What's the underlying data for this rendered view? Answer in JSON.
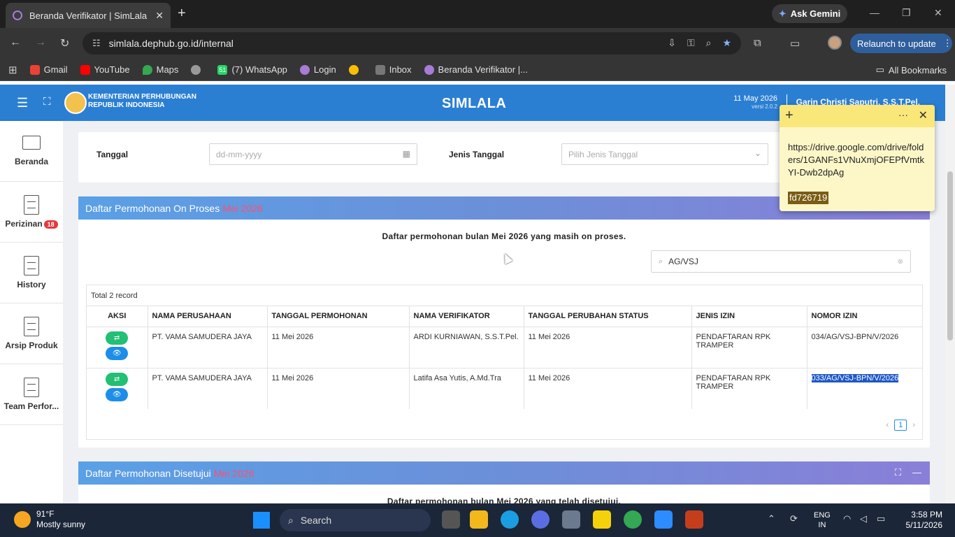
{
  "browser": {
    "tab_title": "Beranda Verifikator | SimLala",
    "gemini_label": "Ask Gemini",
    "url": "simlala.dephub.go.id/internal",
    "relaunch_label": "Relaunch to update",
    "bookmarks": [
      "Gmail",
      "YouTube",
      "Maps",
      "(7) WhatsApp",
      "Login",
      "Inbox",
      "Beranda Verifikator |..."
    ],
    "bookmark_whatsapp_count": "51",
    "all_bookmarks": "All Bookmarks"
  },
  "app": {
    "ministry_line1": "KEMENTERIAN PERHUBUNGAN",
    "ministry_line2": "REPUBLIK INDONESIA",
    "title": "SIMLALA",
    "date": "11 May 2026",
    "version": "versi 2.0.2",
    "user": "Garin Christi Saputri, S.S.T.Pel."
  },
  "sidebar": {
    "items": [
      {
        "label": "Beranda"
      },
      {
        "label": "Perizinan",
        "badge": "18"
      },
      {
        "label": "History"
      },
      {
        "label": "Arsip Produk"
      },
      {
        "label": "Team Perfor..."
      }
    ]
  },
  "filter": {
    "tanggal_label": "Tanggal",
    "tanggal_placeholder": "dd-mm-yyyy",
    "jenis_label": "Jenis Tanggal",
    "jenis_placeholder": "Pilih Jenis Tanggal"
  },
  "panel_onproses": {
    "title": "Daftar Permohonan On Proses",
    "month": "Mei 2026",
    "description": "Daftar permohonan bulan Mei 2026 yang masih on proses.",
    "search_value": "AG/VSJ",
    "total": "Total 2 record",
    "columns": [
      "AKSI",
      "NAMA PERUSAHAAN",
      "TANGGAL PERMOHONAN",
      "NAMA VERIFIKATOR",
      "TANGGAL PERUBAHAN STATUS",
      "JENIS IZIN",
      "NOMOR IZIN"
    ],
    "rows": [
      {
        "perusahaan": "PT. VAMA SAMUDERA JAYA",
        "tgl_permohonan": "11 Mei 2026",
        "verifikator": "ARDI KURNIAWAN, S.S.T.Pel.",
        "tgl_status": "11 Mei 2026",
        "jenis": "PENDAFTARAN RPK TRAMPER",
        "nomor": "034/AG/VSJ-BPN/V/2026"
      },
      {
        "perusahaan": "PT. VAMA SAMUDERA JAYA",
        "tgl_permohonan": "11 Mei 2026",
        "verifikator": "Latifa Asa Yutis, A.Md.Tra",
        "tgl_status": "11 Mei 2026",
        "jenis": "PENDAFTARAN RPK TRAMPER",
        "nomor": "033/AG/VSJ-BPN/V/2026"
      }
    ],
    "page": "1"
  },
  "panel_disetujui": {
    "title": "Daftar Permohonan Disetujui",
    "month": "Mei 2026",
    "description": "Daftar permohonan bulan Mei 2026 yang telah disetujui."
  },
  "sticky_note": {
    "text": "https://drive.google.com/drive/folders/1GANFs1VNuXmjOFEPfVmtkYI-Dwb2dpAg",
    "code": "fd726719"
  },
  "taskbar": {
    "temperature": "91°F",
    "weather": "Mostly sunny",
    "search_label": "Search",
    "lang_line1": "ENG",
    "lang_line2": "IN",
    "time": "3:58 PM",
    "date": "5/11/2026"
  }
}
